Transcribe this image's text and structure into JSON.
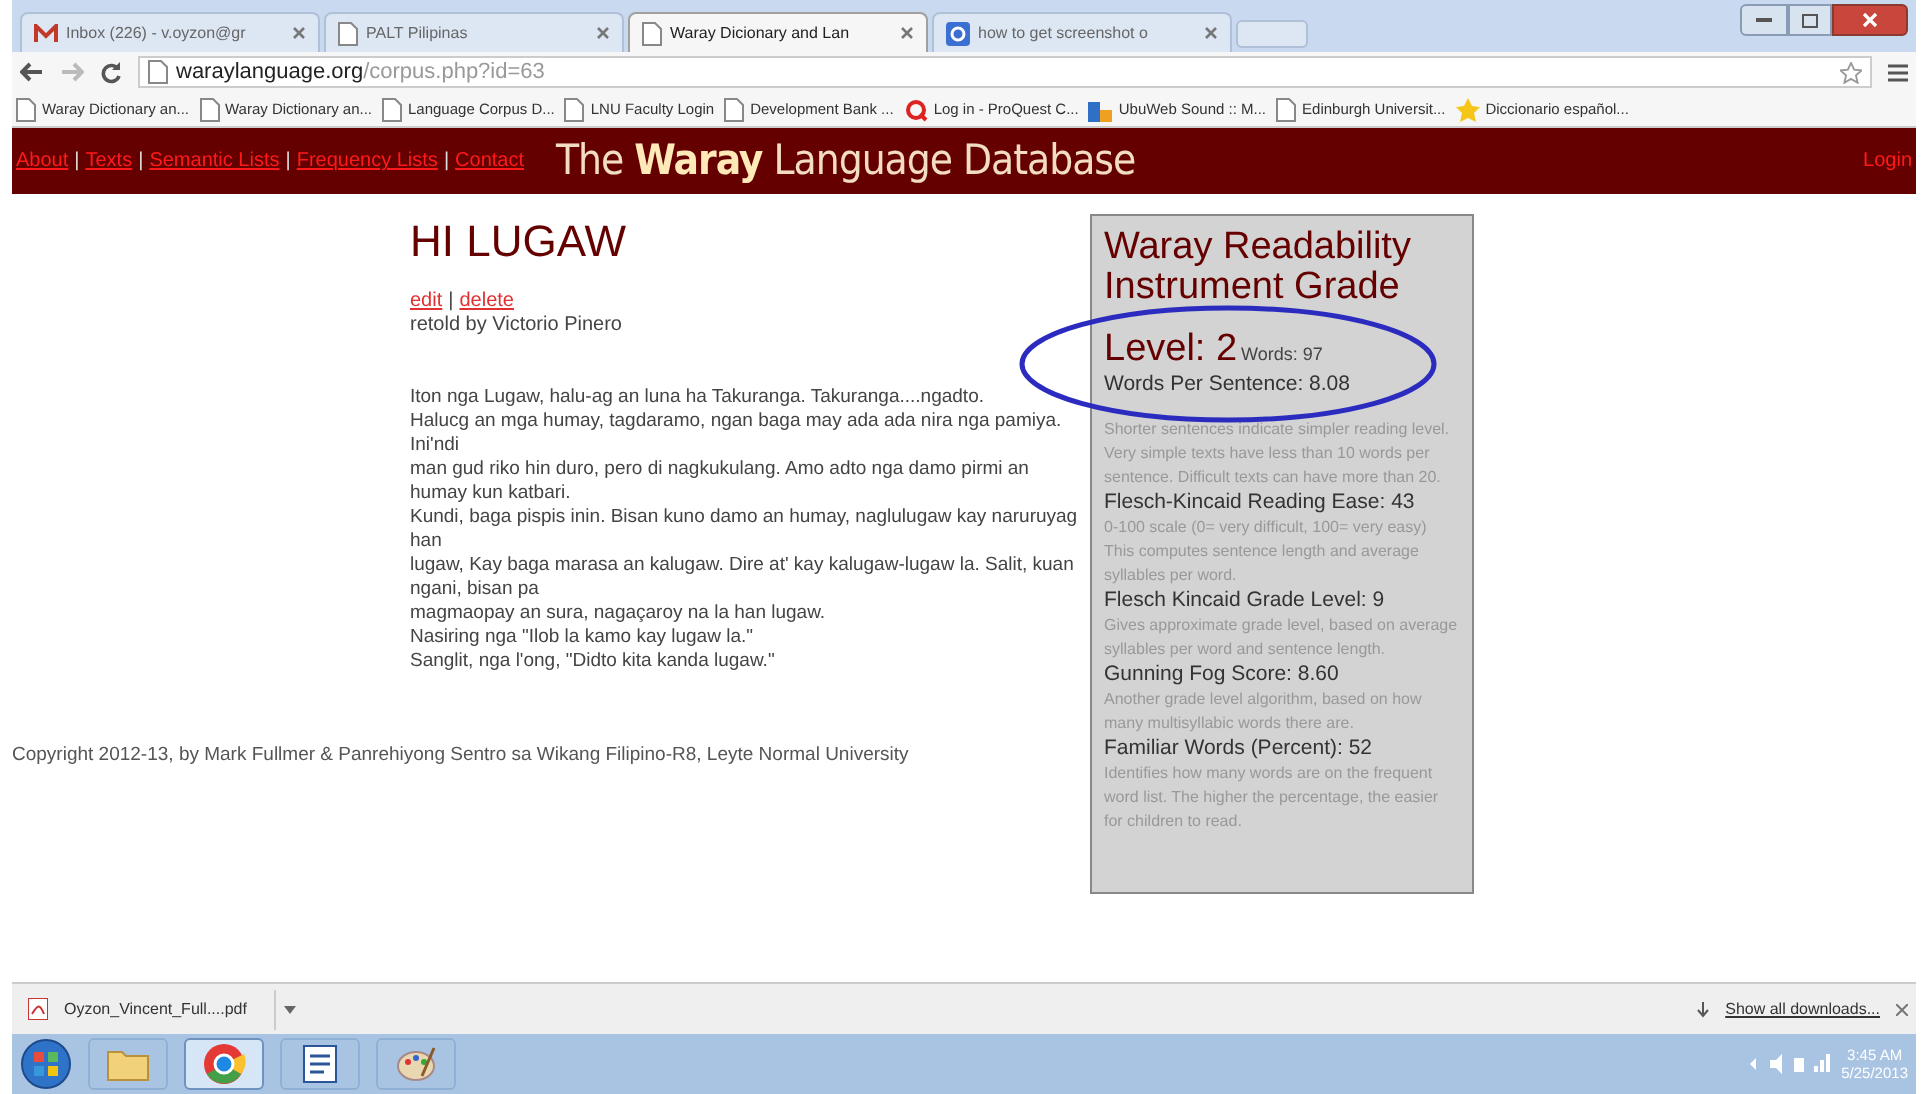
{
  "browser": {
    "tabs": [
      {
        "label": "Inbox (226) - v.oyzon@gr",
        "kind": "mail",
        "selected": false
      },
      {
        "label": "PALT Pilipinas",
        "kind": "page",
        "selected": false
      },
      {
        "label": "Waray Dicionary and Lan",
        "kind": "page",
        "selected": true
      },
      {
        "label": "how to get screenshot o",
        "kind": "search",
        "selected": false
      }
    ],
    "url_host": "waraylanguage.org",
    "url_path": "/corpus.php?id=63",
    "bookmarks": [
      {
        "label": "Waray Dictionary an...",
        "kind": "page"
      },
      {
        "label": "Waray Dictionary an...",
        "kind": "page"
      },
      {
        "label": "Language Corpus D...",
        "kind": "page"
      },
      {
        "label": "LNU Faculty Login",
        "kind": "page"
      },
      {
        "label": "Development Bank ...",
        "kind": "page"
      },
      {
        "label": "Log in - ProQuest C...",
        "kind": "q"
      },
      {
        "label": "UbuWeb Sound :: M...",
        "kind": "bars"
      },
      {
        "label": "Edinburgh Universit...",
        "kind": "page"
      },
      {
        "label": "Diccionario español...",
        "kind": "star"
      }
    ]
  },
  "site": {
    "nav": [
      "About",
      "Texts",
      "Semantic Lists",
      "Frequency Lists",
      "Contact"
    ],
    "separator": "|",
    "title_before": "The",
    "title_bold": "Waray",
    "title_after": "Language Database",
    "login": "Login"
  },
  "text": {
    "title": "HI LUGAW",
    "actions": [
      "edit",
      "delete"
    ],
    "separator": "|",
    "byline": "retold by Victorio Pinero",
    "lines": [
      "Iton nga Lugaw, halu-ag an luna ha Takuranga. Takuranga....ngadto.",
      "Halucg an mga humay, tagdaramo, ngan baga may ada ada nira nga pamiya. Ini'ndi",
      "man gud riko hin duro, pero di nagkukulang. Amo adto nga damo pirmi an humay kun katbari.",
      "Kundi, baga pispis inin. Bisan kuno damo an humay, naglulugaw kay naruruyag han",
      "lugaw, Kay baga marasa an kalugaw. Dire at' kay kalugaw-lugaw la. Salit, kuan ngani, bisan pa",
      "magmaopay an sura, nagaçaroy na la han lugaw.",
      "Nasiring nga \"Ilob la kamo kay lugaw la.\"",
      "Sanglit, nga l'ong, \"Didto kita kanda lugaw.\""
    ],
    "copyright": "Copyright 2012-13, by Mark Fullmer & Panrehiyong Sentro sa Wikang Filipino-R8, Leyte Normal University"
  },
  "readability": {
    "heading": "Waray Readability Instrument Grade",
    "level_label": "Level: 2",
    "words": "Words: 97",
    "metrics": [
      {
        "label": "Words Per Sentence: 8.08",
        "note": "Shorter sentences indicate simpler reading level. Very simple texts have less than 10 words per sentence. Difficult texts can have more than 20."
      },
      {
        "label": "Flesch-Kincaid Reading Ease: 43",
        "note": "0-100 scale (0= very difficult, 100= very easy) This computes sentence length and average syllables per word."
      },
      {
        "label": "Flesch Kincaid Grade Level: 9",
        "note": "Gives approximate grade level, based on average syllables per word and sentence length."
      },
      {
        "label": "Gunning Fog Score: 8.60",
        "note": "Another grade level algorithm, based on how many multisyllabic words there are."
      },
      {
        "label": "Familiar Words (Percent): 52",
        "note": "Identifies how many words are on the frequent word list. The higher the percentage, the easier for children to read."
      }
    ]
  },
  "downloads": {
    "file": "Oyzon_Vincent_Full....pdf",
    "show_all": "Show all downloads..."
  },
  "taskbar": {
    "apps": [
      {
        "kind": "folder",
        "selected": false
      },
      {
        "kind": "chrome",
        "selected": true
      },
      {
        "kind": "word",
        "selected": false
      },
      {
        "kind": "paint",
        "selected": false
      }
    ],
    "time": "3:45 AM",
    "date": "5/25/2013"
  }
}
